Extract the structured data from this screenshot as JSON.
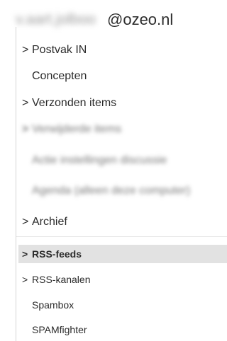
{
  "account": {
    "name_blurred": "v.aart.jolboo",
    "domain": "@ozeo.nl"
  },
  "folders": [
    {
      "label": "Postvak IN",
      "chevron": ">"
    },
    {
      "label": "Concepten",
      "chevron": ""
    },
    {
      "label": "Verzonden items",
      "chevron": ">"
    },
    {
      "label": "Verwijderde items",
      "chevron": ">"
    },
    {
      "label": "Actie instellingen discussie",
      "chevron": ""
    },
    {
      "label": "Agenda (alleen deze computer)",
      "chevron": ""
    },
    {
      "label": "Archief",
      "chevron": ">"
    },
    {
      "label": "RSS-feeds",
      "chevron": ">"
    },
    {
      "label": "RSS-kanalen",
      "chevron": ">"
    },
    {
      "label": "Spambox",
      "chevron": ""
    },
    {
      "label": "SPAMfighter",
      "chevron": ""
    }
  ]
}
